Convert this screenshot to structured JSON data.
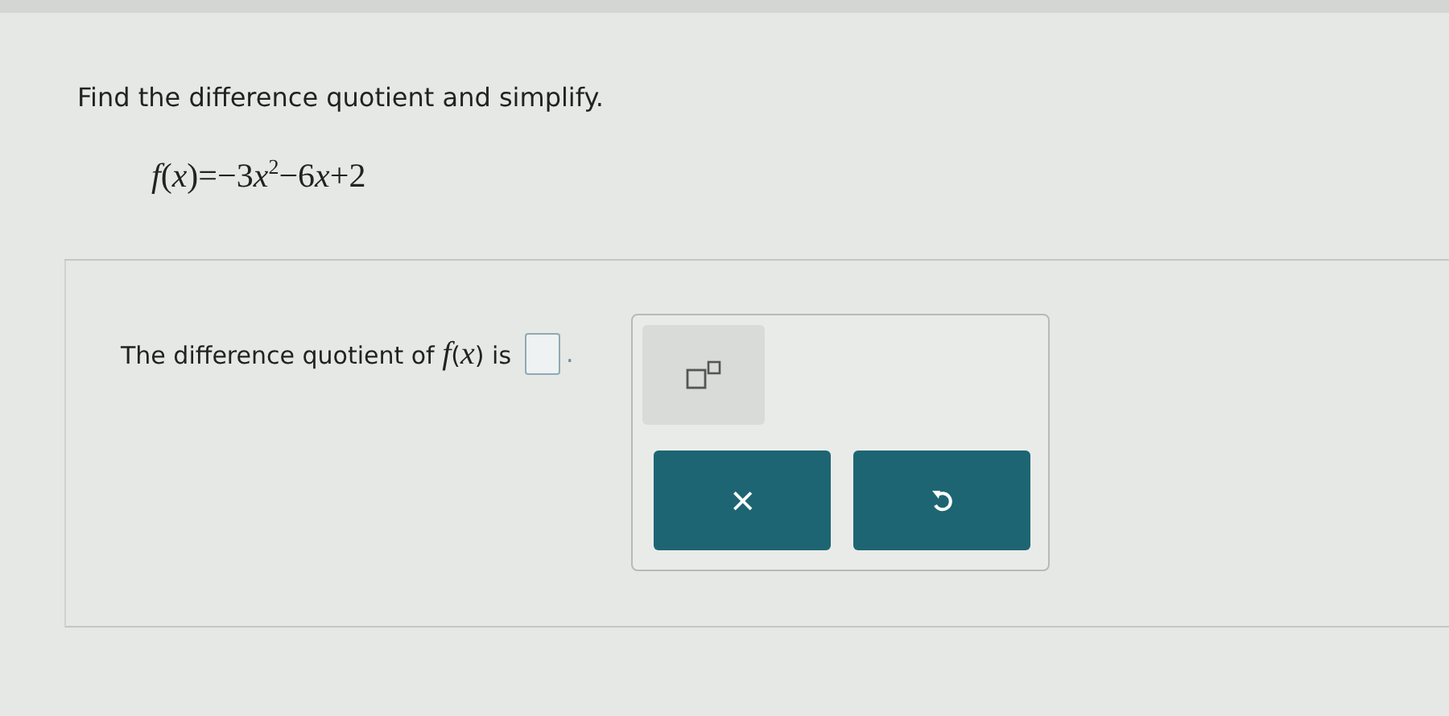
{
  "question": "Find the difference quotient and simplify.",
  "function": [
    {
      "kind": "var",
      "text": "f"
    },
    {
      "kind": "text",
      "text": "("
    },
    {
      "kind": "var",
      "text": "x"
    },
    {
      "kind": "text",
      "text": ")=−3"
    },
    {
      "kind": "var",
      "text": "x"
    },
    {
      "kind": "sup",
      "text": "2"
    },
    {
      "kind": "text",
      "text": "−6"
    },
    {
      "kind": "var",
      "text": "x"
    },
    {
      "kind": "text",
      "text": "+2"
    }
  ],
  "answer": {
    "sentence": [
      {
        "kind": "text",
        "text": "The difference quotient of "
      },
      {
        "kind": "var",
        "text": "f"
      },
      {
        "kind": "text",
        "text": "("
      },
      {
        "kind": "var",
        "text": "x"
      },
      {
        "kind": "text",
        "text": ") is"
      }
    ],
    "end": "."
  },
  "palette": {
    "clear_label": "×"
  }
}
